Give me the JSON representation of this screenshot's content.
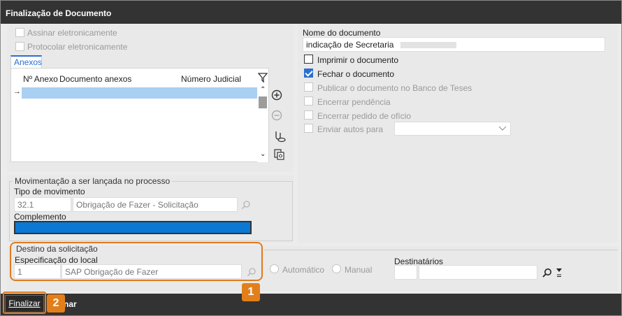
{
  "window": {
    "title": "Finalização de Documento"
  },
  "left": {
    "assinar_label": "Assinar eletronicamente",
    "protocolar_label": "Protocolar eletronicamente",
    "tab_anexos": "Anexos",
    "table": {
      "columns": [
        "Nº Anexo",
        "Documento anexos",
        "Número Judicial"
      ],
      "row_marker": "→"
    }
  },
  "right": {
    "nome_label": "Nome do documento",
    "nome_value": "indicação de Secretaria",
    "options": [
      {
        "label": "Imprimir o documento",
        "checked": false,
        "enabled": true
      },
      {
        "label": "Fechar o documento",
        "checked": true,
        "enabled": true
      },
      {
        "label": "Publicar o documento no Banco de Teses",
        "checked": false,
        "enabled": false
      },
      {
        "label": "Encerrar pendência",
        "checked": false,
        "enabled": false
      },
      {
        "label": "Encerrar pedido de ofício",
        "checked": false,
        "enabled": false
      },
      {
        "label": "Enviar autos para",
        "checked": false,
        "enabled": false
      }
    ]
  },
  "movimentacao": {
    "legend": "Movimentação a ser lançada no processo",
    "tipo_label": "Tipo de movimento",
    "tipo_code": "32.1",
    "tipo_desc": "Obrigação de Fazer - Solicitação",
    "complemento_label": "Complemento"
  },
  "destino": {
    "legend": "Destino da solicitação",
    "especificacao_label": "Especificação do local",
    "local_code": "1",
    "local_desc": "SAP Obrigação de Fazer",
    "radio_auto": "Automático",
    "radio_manual": "Manual",
    "destinatarios_label": "Destinatários"
  },
  "footer": {
    "finalizar_label": "Finalizar",
    "cancelar_partial": "nar"
  },
  "callouts": [
    "1",
    "2"
  ],
  "colors": {
    "accent": "#e27f1b",
    "selection": "#0b78d4",
    "titlebar": "#333333"
  }
}
